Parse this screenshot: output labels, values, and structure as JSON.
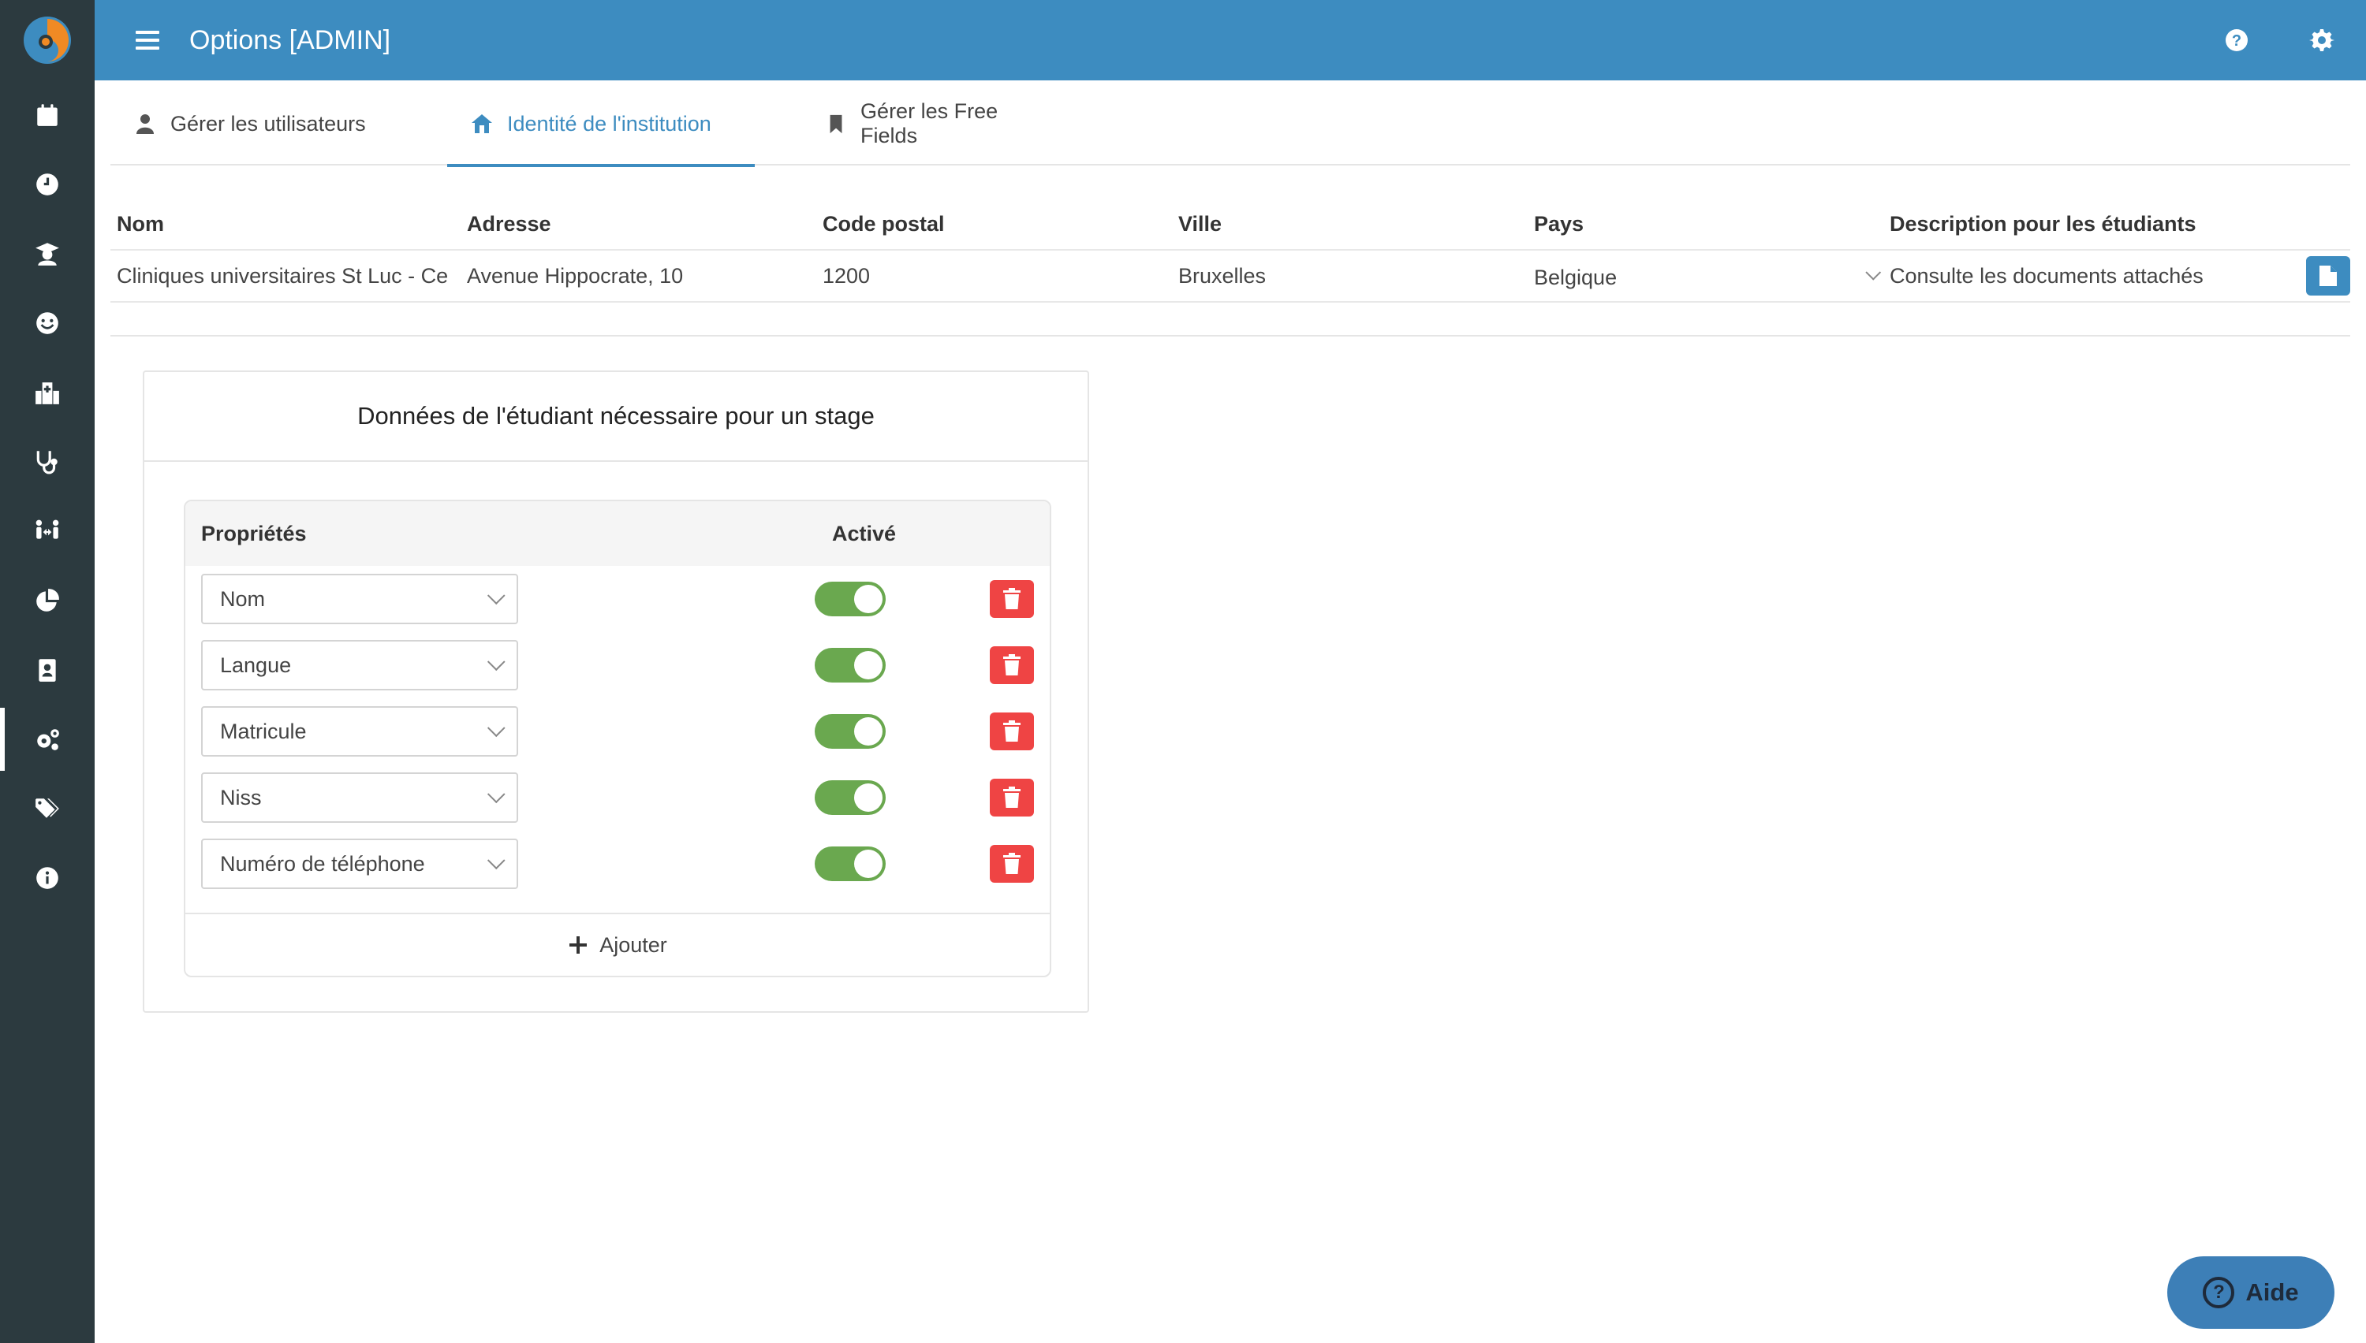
{
  "header": {
    "title": "Options [ADMIN]"
  },
  "sidebar": {
    "items": [
      {
        "icon": "calendar-icon"
      },
      {
        "icon": "clock-icon"
      },
      {
        "icon": "graduate-icon"
      },
      {
        "icon": "smile-icon"
      },
      {
        "icon": "hospital-icon"
      },
      {
        "icon": "stethoscope-icon"
      },
      {
        "icon": "people-arrows-icon"
      },
      {
        "icon": "pie-chart-icon"
      },
      {
        "icon": "id-badge-icon"
      },
      {
        "icon": "cogs-icon",
        "active": true
      },
      {
        "icon": "tags-icon"
      },
      {
        "icon": "info-icon"
      }
    ]
  },
  "tabs": [
    {
      "label": "Gérer les utilisateurs",
      "icon": "user-icon"
    },
    {
      "label": "Identité de l'institution",
      "icon": "home-icon",
      "active": true
    },
    {
      "label": "Gérer les Free Fields",
      "icon": "bookmark-icon"
    }
  ],
  "institution": {
    "headers": {
      "nom": "Nom",
      "adresse": "Adresse",
      "code_postal": "Code postal",
      "ville": "Ville",
      "pays": "Pays",
      "description": "Description pour les étudiants"
    },
    "row": {
      "nom": "Cliniques universitaires St Luc - Ce",
      "adresse": "Avenue Hippocrate, 10",
      "code_postal": "1200",
      "ville": "Bruxelles",
      "pays": "Belgique",
      "description": "Consulte les documents attachés"
    }
  },
  "card": {
    "title": "Données de l'étudiant nécessaire pour un stage",
    "col_properties": "Propriétés",
    "col_active": "Activé",
    "properties": [
      {
        "label": "Nom",
        "active": true
      },
      {
        "label": "Langue",
        "active": true
      },
      {
        "label": "Matricule",
        "active": true
      },
      {
        "label": "Niss",
        "active": true
      },
      {
        "label": "Numéro de téléphone",
        "active": true
      }
    ],
    "add_label": "Ajouter"
  },
  "help": {
    "label": "Aide"
  },
  "colors": {
    "header": "#3d8cc0",
    "sidebar": "#2c3a3f",
    "toggle_on": "#6aa84f",
    "delete": "#ef4444"
  }
}
